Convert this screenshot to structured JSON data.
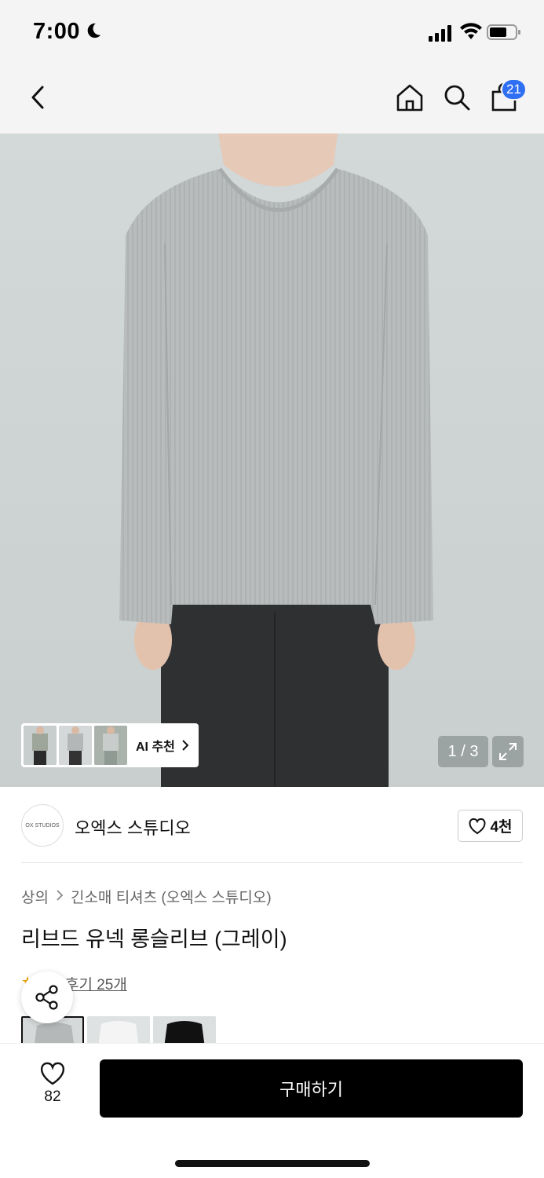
{
  "status_bar": {
    "time": "7:00"
  },
  "header": {
    "cart_count": "21"
  },
  "gallery": {
    "ai_recommend_label": "AI 추천",
    "image_counter": "1 / 3"
  },
  "brand": {
    "logo_text": "OX STUDIOS",
    "name": "오엑스 스튜디오",
    "likes": "4천"
  },
  "product": {
    "breadcrumb": [
      "상의",
      "긴소매 티셔츠 (오엑스 스튜디오)"
    ],
    "title": "리브드 유넥 롱슬리브 (그레이)",
    "review_text": "후기 25개",
    "color_options": [
      "그레이",
      "화이트",
      "블랙"
    ]
  },
  "bottom_bar": {
    "wishlist_count": "82",
    "buy_label": "구매하기"
  },
  "colors": {
    "badge": "#2f6ff3",
    "buy_button": "#000000",
    "shirt": "#b9bcbc",
    "pants": "#2f3032"
  }
}
